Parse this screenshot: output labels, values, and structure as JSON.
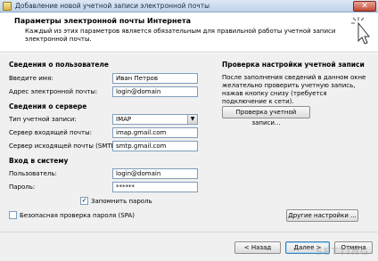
{
  "window": {
    "title": "Добавление новой учетной записи электронной почты",
    "close_glyph": "✕"
  },
  "header": {
    "title": "Параметры электронной почты Интернета",
    "subtitle": "Каждый из этих параметров является обязательным для правильной работы учетной записи электронной почты."
  },
  "user_info": {
    "title": "Сведения о пользователе",
    "name_label": "Введите имя:",
    "name_value": "Иван Петров",
    "email_label": "Адрес электронной почты:",
    "email_value": "login@domain"
  },
  "server_info": {
    "title": "Сведения о сервере",
    "account_type_label": "Тип учетной записи:",
    "account_type_value": "IMAP",
    "incoming_label": "Сервер входящей почты:",
    "incoming_value": "imap.gmail.com",
    "outgoing_label": "Сервер исходящей почты (SMTP):",
    "outgoing_value": "smtp.gmail.com"
  },
  "login": {
    "title": "Вход в систему",
    "user_label": "Пользователь:",
    "user_value": "login@domain",
    "password_label": "Пароль:",
    "password_value": "******",
    "remember_label": "Запомнить пароль",
    "remember_checked": true,
    "spa_label": "Безопасная проверка пароля (SPA)",
    "spa_checked": false
  },
  "test": {
    "title": "Проверка настройки учетной записи",
    "description": "После заполнения сведений в данном окне желательно проверить учетную запись, нажав кнопку снизу (требуется подключение к сети).",
    "test_button": "Проверка учетной записи...",
    "more_button": "Другие настройки ..."
  },
  "footer": {
    "back_button": "< Назад",
    "next_button": "Далее >",
    "cancel_button": "Отмена"
  },
  "watermark": "SETTING"
}
